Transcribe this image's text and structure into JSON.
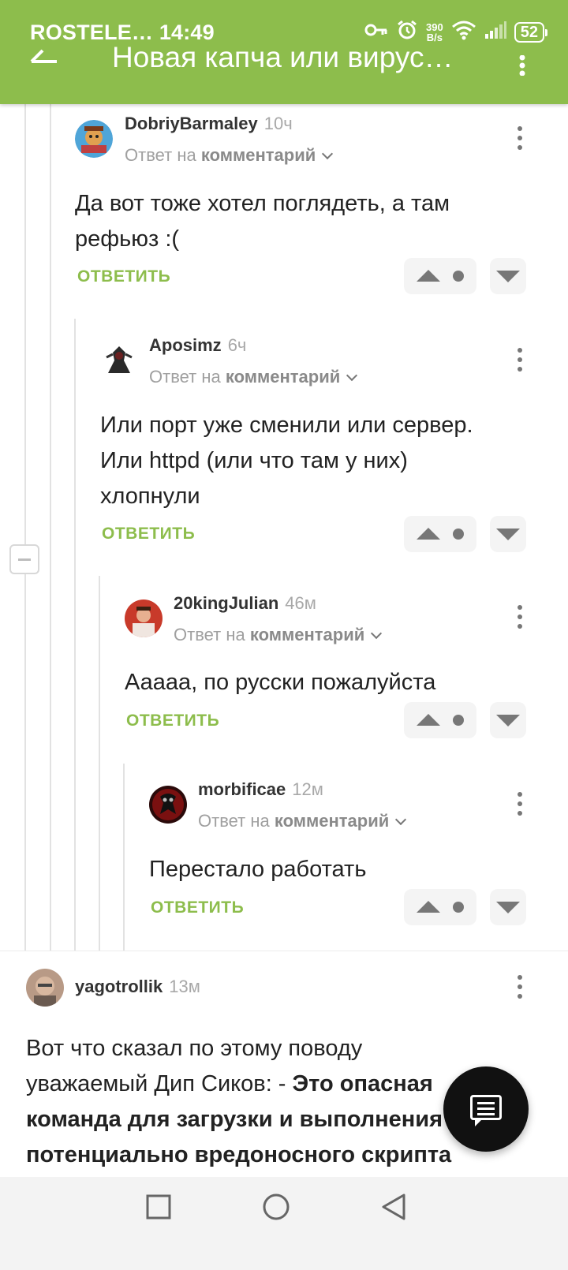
{
  "status_bar": {
    "carrier_time": "ROSTELE… 14:49",
    "net_speed_value": "390",
    "net_speed_unit": "B/s",
    "battery": "52"
  },
  "appbar": {
    "title": "Новая капча или вирус…"
  },
  "comments": [
    {
      "author": "DobriyBarmaley",
      "time": "10ч",
      "reply_prefix": "Ответ на",
      "reply_target": "комментарий",
      "text_lines": [
        "Да вот тоже хотел поглядеть, а там",
        "рефьюз :("
      ],
      "reply_label": "ОТВЕТИТЬ"
    },
    {
      "author": "Aposimz",
      "time": "6ч",
      "reply_prefix": "Ответ на",
      "reply_target": "комментарий",
      "text_lines": [
        "Или порт уже сменили или сервер.",
        "Или httpd (или что там у них)",
        "хлопнули"
      ],
      "reply_label": "ОТВЕТИТЬ"
    },
    {
      "author": "20kingJulian",
      "time": "46м",
      "reply_prefix": "Ответ на",
      "reply_target": "комментарий",
      "text_lines": [
        "Ааааа, по русски пожалуйста"
      ],
      "reply_label": "ОТВЕТИТЬ"
    },
    {
      "author": "morbificae",
      "time": "12м",
      "reply_prefix": "Ответ на",
      "reply_target": "комментарий",
      "text_lines": [
        "Перестало работать"
      ],
      "reply_label": "ОТВЕТИТЬ"
    }
  ],
  "root_comment": {
    "author": "yagotrollik",
    "time": "13м",
    "line1": "Вот что сказал по этому поводу",
    "line2_normal": "уважаемый Дип Сиков: - ",
    "line2_bold": "Это опасная",
    "line3_bold": "команда для загрузки и выполнения",
    "line4_bold": "потенциально вредоносного скрипта"
  },
  "icons": {
    "status": [
      "key-icon",
      "alarm-icon",
      "wifi-icon",
      "signal-icon",
      "battery-icon"
    ],
    "appbar": [
      "back-arrow-icon",
      "more-vert-icon"
    ],
    "comment": [
      "upvote-icon",
      "rating-dot-icon",
      "downvote-icon",
      "kebab-icon"
    ],
    "fab": "chat-icon",
    "nav": [
      "recents-icon",
      "home-icon",
      "back-icon"
    ]
  },
  "colors": {
    "brand_green": "#8dbd4c",
    "vote_bg": "#f4f4f4",
    "fab_bg": "#111111"
  }
}
